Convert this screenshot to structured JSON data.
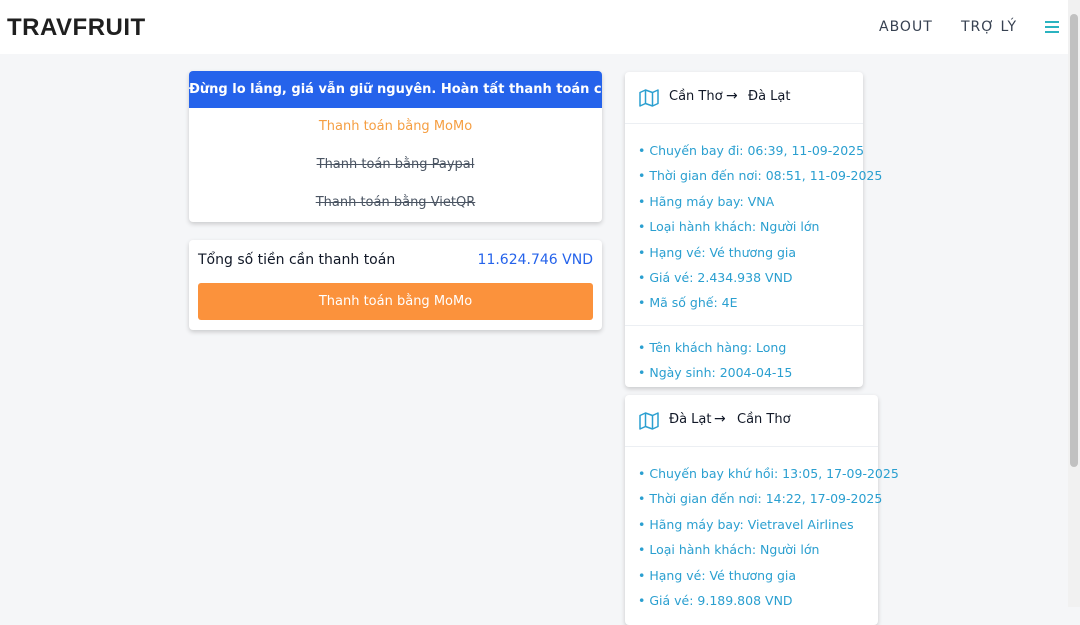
{
  "header": {
    "logo": "TRAVFRUIT",
    "nav": {
      "about": "ABOUT",
      "assistant": "TRỢ LÝ"
    },
    "menu_icon": "hamburger-menu-icon"
  },
  "payment": {
    "header": "Đừng lo lắng, giá vẫn giữ nguyên. Hoàn tất thanh toán của bạn bằng",
    "options": [
      {
        "label": "Thanh toán bằng MoMo",
        "state": "active"
      },
      {
        "label": "Thanh toán bằng Paypal",
        "state": "disabled"
      },
      {
        "label": "Thanh toán bằng VietQR",
        "state": "disabled"
      }
    ],
    "total_label": "Tổng số tiền cần thanh toán",
    "total_amount": "11.624.746 VND",
    "pay_button": "Thanh toán bằng MoMo"
  },
  "flights": [
    {
      "from": "Cần Thơ",
      "to": "Đà Lạt",
      "arrow": "→",
      "icon": "map-icon",
      "details": [
        "Chuyến bay đi: 06:39, 11-09-2025",
        "Thời gian đến nơi: 08:51, 11-09-2025",
        "Hãng máy bay: VNA",
        "Loại hành khách: Người lớn",
        "Hạng vé: Vé thương gia",
        "Giá vé: 2.434.938 VND",
        "Mã số ghế: 4E"
      ],
      "passenger": [
        "Tên khách hàng: Long",
        "Ngày sinh: 2004-04-15"
      ]
    },
    {
      "from": "Đà Lạt",
      "to": "Cần Thơ",
      "arrow": "→",
      "icon": "map-icon",
      "details": [
        "Chuyến bay khứ hồi: 13:05, 17-09-2025",
        "Thời gian đến nơi: 14:22, 17-09-2025",
        "Hãng máy bay: Vietravel Airlines",
        "Loại hành khách: Người lớn",
        "Hạng vé: Vé thương gia",
        "Giá vé: 9.189.808 VND"
      ]
    }
  ],
  "colors": {
    "primary_blue": "#2563eb",
    "accent_orange": "#fb923c",
    "detail_text": "#2a9fd0",
    "menu_teal": "#2bb3c0"
  }
}
